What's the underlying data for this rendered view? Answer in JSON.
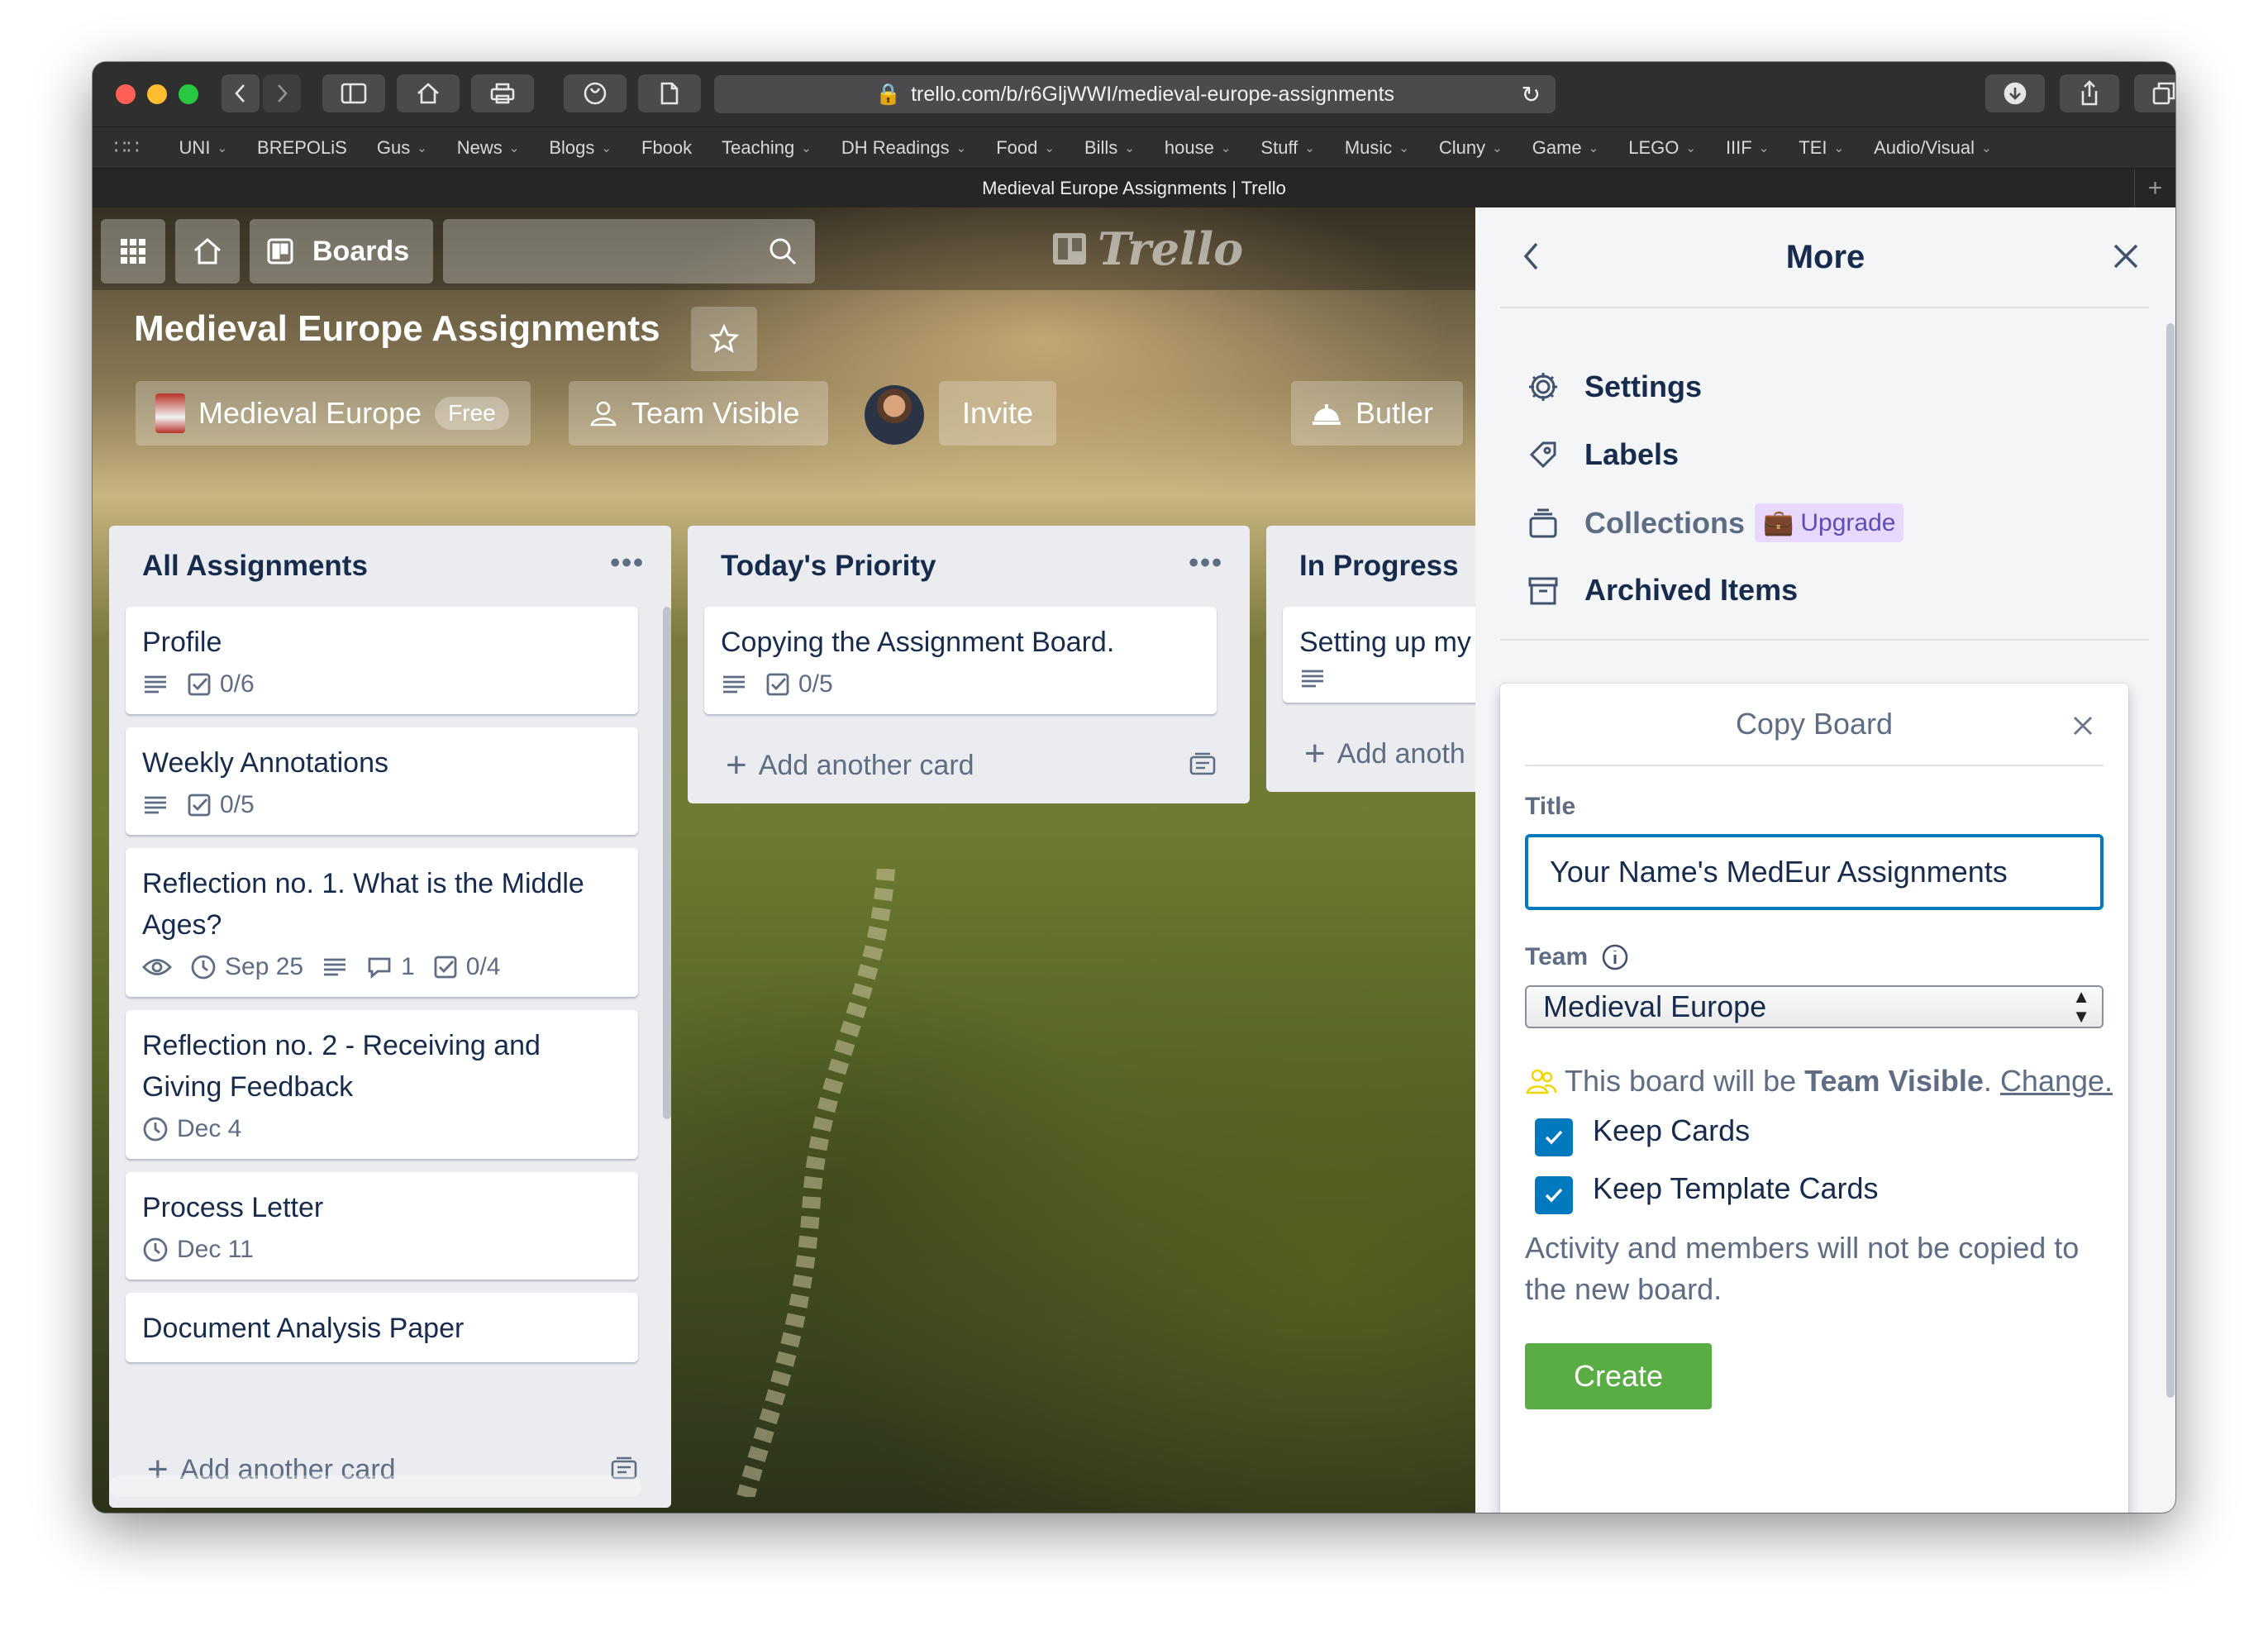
{
  "browser": {
    "url": "trello.com/b/r6GljWWI/medieval-europe-assignments",
    "tab_title": "Medieval Europe Assignments | Trello",
    "bookmarks": [
      {
        "label": "UNI",
        "menu": true
      },
      {
        "label": "BREPOLiS",
        "menu": false
      },
      {
        "label": "Gus",
        "menu": true
      },
      {
        "label": "News",
        "menu": true
      },
      {
        "label": "Blogs",
        "menu": true
      },
      {
        "label": "Fbook",
        "menu": false
      },
      {
        "label": "Teaching",
        "menu": true
      },
      {
        "label": "DH Readings",
        "menu": true
      },
      {
        "label": "Food",
        "menu": true
      },
      {
        "label": "Bills",
        "menu": true
      },
      {
        "label": "house",
        "menu": true
      },
      {
        "label": "Stuff",
        "menu": true
      },
      {
        "label": "Music",
        "menu": true
      },
      {
        "label": "Cluny",
        "menu": true
      },
      {
        "label": "Game",
        "menu": true
      },
      {
        "label": "LEGO",
        "menu": true
      },
      {
        "label": "IIIF",
        "menu": true
      },
      {
        "label": "TEI",
        "menu": true
      },
      {
        "label": "Audio/Visual",
        "menu": true
      }
    ],
    "chevron": "⌄"
  },
  "header": {
    "boards_label": "Boards",
    "logo_text": "Trello"
  },
  "board": {
    "title": "Medieval Europe Assignments",
    "team_name": "Medieval Europe",
    "team_badge": "Free",
    "visibility": "Team Visible",
    "invite_label": "Invite",
    "butler_label": "Butler"
  },
  "lists": [
    {
      "title": "All Assignments",
      "cards": [
        {
          "title": "Profile",
          "badges": [
            {
              "type": "description"
            },
            {
              "type": "checklist",
              "text": "0/6"
            }
          ]
        },
        {
          "title": "Weekly Annotations",
          "badges": [
            {
              "type": "description"
            },
            {
              "type": "checklist",
              "text": "0/5"
            }
          ]
        },
        {
          "title": "Reflection no. 1. What is the Middle Ages?",
          "badges": [
            {
              "type": "watch"
            },
            {
              "type": "due",
              "text": "Sep 25"
            },
            {
              "type": "description"
            },
            {
              "type": "comments",
              "text": "1"
            },
            {
              "type": "checklist",
              "text": "0/4"
            }
          ]
        },
        {
          "title": "Reflection no. 2 - Receiving and Giving Feedback",
          "badges": [
            {
              "type": "due",
              "text": "Dec 4"
            }
          ]
        },
        {
          "title": "Process Letter",
          "badges": [
            {
              "type": "due",
              "text": "Dec 11"
            }
          ]
        },
        {
          "title": "Document Analysis Paper",
          "badges": []
        }
      ],
      "add_label": "Add another card"
    },
    {
      "title": "Today's Priority",
      "cards": [
        {
          "title": "Copying the Assignment Board.",
          "badges": [
            {
              "type": "description"
            },
            {
              "type": "checklist",
              "text": "0/5"
            }
          ]
        }
      ],
      "add_label": "Add another card"
    },
    {
      "title": "In Progress",
      "cards": [
        {
          "title": "Setting up my",
          "badges": [
            {
              "type": "description"
            }
          ]
        }
      ],
      "add_label": "Add anoth"
    }
  ],
  "more_menu": {
    "title": "More",
    "items": [
      {
        "label": "Settings",
        "icon": "gear-icon"
      },
      {
        "label": "Labels",
        "icon": "label-icon"
      },
      {
        "label": "Collections",
        "icon": "collections-icon",
        "upgrade": "Upgrade"
      },
      {
        "label": "Archived Items",
        "icon": "archive-icon"
      }
    ]
  },
  "copy_board": {
    "title": "Copy Board",
    "title_label": "Title",
    "title_value": "Your Name's MedEur Assignments",
    "team_label": "Team",
    "team_value": "Medieval Europe",
    "visibility_prefix": "This board will be ",
    "visibility_value": "Team Visible",
    "visibility_suffix": ". ",
    "change_link": "Change.",
    "keep_cards": "Keep Cards",
    "keep_template_cards": "Keep Template Cards",
    "keep_cards_checked": true,
    "keep_template_checked": true,
    "note": "Activity and members will not be copied to the new board.",
    "create_label": "Create"
  },
  "colors": {
    "accent": "#0079bf",
    "create": "#5aac44",
    "upgrade_bg": "#e9d8fd"
  }
}
